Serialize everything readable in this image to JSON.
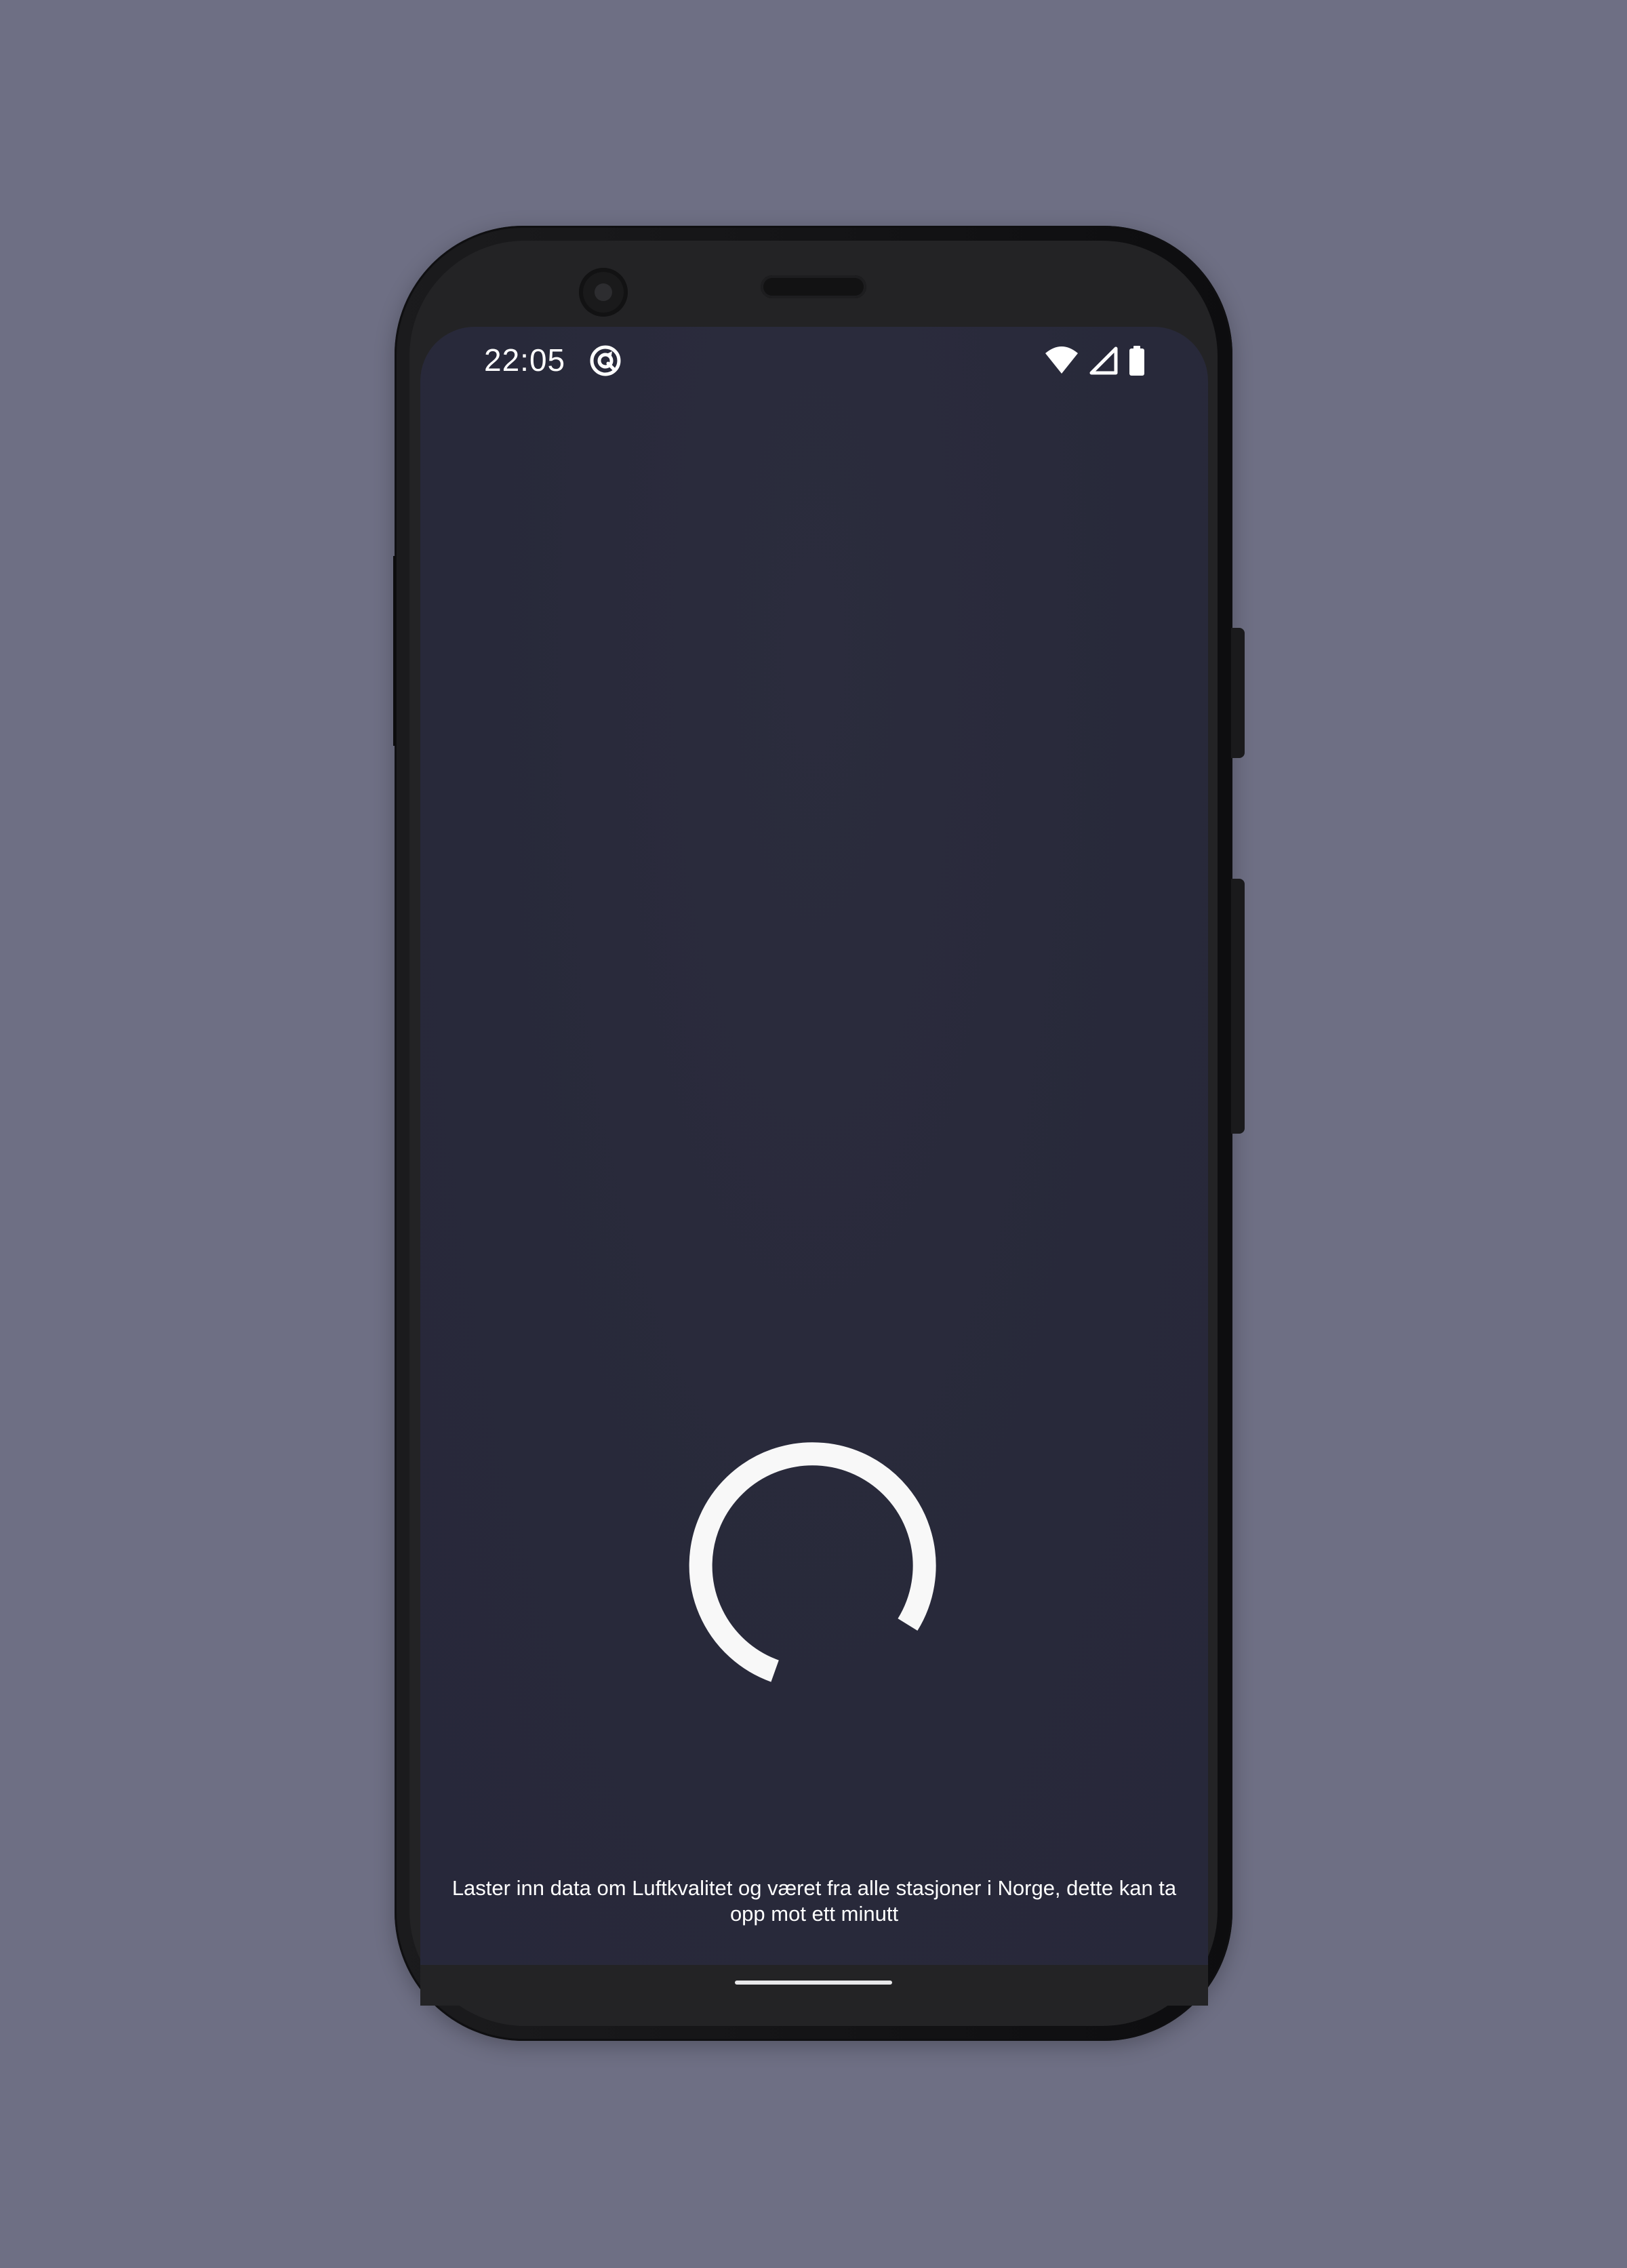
{
  "status_bar": {
    "time": "22:05",
    "app_icon": "data-sync-icon",
    "icons": [
      "wifi-icon",
      "cell-signal-icon",
      "battery-icon"
    ]
  },
  "loading": {
    "spinner_icon": "progress-spinner-icon",
    "message": "Laster inn data om Luftkvalitet og været fra alle stasjoner i Norge, dette kan ta opp mot ett minutt"
  },
  "colors": {
    "backdrop": "#6e6f84",
    "screen_background": "#292a3b",
    "foreground": "#ffffff"
  }
}
